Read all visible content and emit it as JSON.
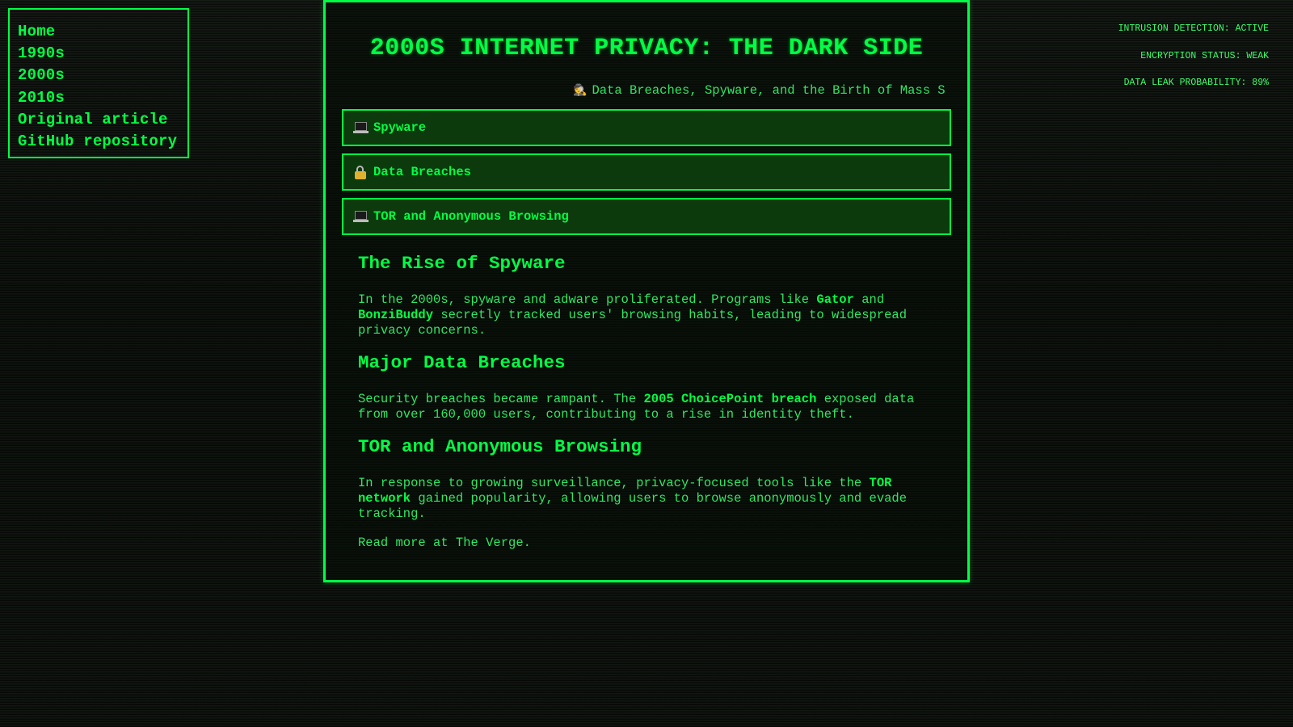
{
  "nav": {
    "items": [
      {
        "label": "Home"
      },
      {
        "label": "1990s"
      },
      {
        "label": "2000s"
      },
      {
        "label": "2010s"
      },
      {
        "label": "Original article"
      },
      {
        "label": "GitHub repository"
      }
    ]
  },
  "status": {
    "intrusion": "INTRUSION DETECTION: ACTIVE",
    "encryption": "ENCRYPTION STATUS: WEAK",
    "leak": "DATA LEAK PROBABILITY: 89%"
  },
  "main": {
    "title": "2000S INTERNET PRIVACY: THE DARK SIDE",
    "ticker": {
      "icon": "spy-icon",
      "text": "Data Breaches, Spyware, and the Birth of Mass S"
    },
    "tabs": [
      {
        "label": "Spyware",
        "icon": "laptop-icon"
      },
      {
        "label": "Data Breaches",
        "icon": "lock-icon"
      },
      {
        "label": "TOR and Anonymous Browsing",
        "icon": "laptop-icon"
      }
    ],
    "sections": [
      {
        "heading": "The Rise of Spyware",
        "p_before": "In the 2000s, spyware and adware proliferated. Programs like ",
        "strong1": "Gator",
        "p_mid": " and ",
        "strong2": "BonziBuddy",
        "p_after": " secretly tracked users' browsing habits, leading to widespread privacy concerns."
      },
      {
        "heading": "Major Data Breaches",
        "p_before": "Security breaches became rampant. The ",
        "strong1": "2005 ChoicePoint breach",
        "p_after": " exposed data from over 160,000 users, contributing to a rise in identity theft."
      },
      {
        "heading": "TOR and Anonymous Browsing",
        "p_before": "In response to growing surveillance, privacy-focused tools like the ",
        "strong1": "TOR network",
        "p_after": " gained popularity, allowing users to browse anonymously and evade tracking."
      }
    ],
    "read_more": "Read more at The Verge."
  },
  "colors": {
    "accent": "#00ff44",
    "tab_bg": "#0c3a0c",
    "background": "#0b0b0b"
  }
}
